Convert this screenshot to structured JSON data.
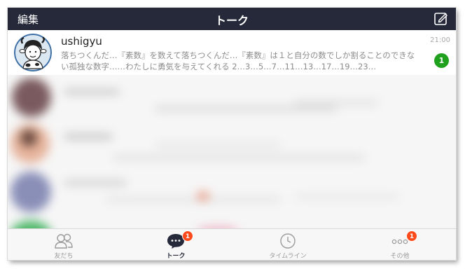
{
  "header": {
    "edit_label": "編集",
    "title": "トーク",
    "compose_icon": "compose-icon"
  },
  "chat": {
    "name": "ushigyu",
    "time": "21:00",
    "preview": "落ちつくんだ…『素数』を数えて落ちつくんだ…『素数』は１と自分の数でしか割ることのできない孤独な数字……わたしに勇気を与えてくれる 2…3…5…7…11…13…17…19…23…",
    "unread": "1"
  },
  "tabs": [
    {
      "label": "友だち",
      "icon": "friends-icon",
      "badge": ""
    },
    {
      "label": "トーク",
      "icon": "chat-bubble-icon",
      "badge": "1"
    },
    {
      "label": "タイムライン",
      "icon": "clock-icon",
      "badge": ""
    },
    {
      "label": "その他",
      "icon": "more-icon",
      "badge": "1"
    }
  ],
  "colors": {
    "header_bg": "#26293a",
    "unread_badge": "#1fa11d",
    "tab_badge": "#ff4a1c"
  }
}
